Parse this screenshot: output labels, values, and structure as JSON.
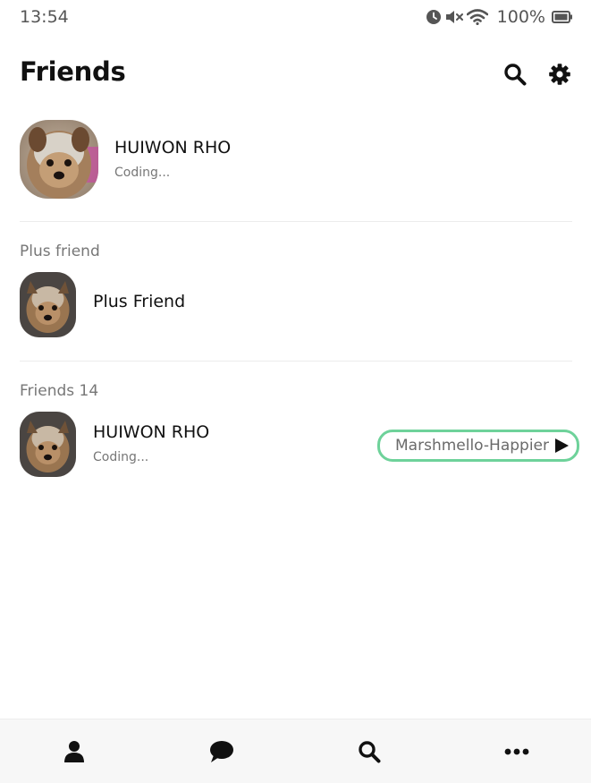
{
  "status_bar": {
    "time": "13:54",
    "battery": "100%",
    "icons": [
      "alarm-icon",
      "mute-icon",
      "wifi-icon",
      "battery-icon"
    ]
  },
  "header": {
    "title": "Friends",
    "icons": [
      "search-icon",
      "gear-icon"
    ]
  },
  "my_profile": {
    "name": "HUIWON RHO",
    "status": "Coding..."
  },
  "plus_friend": {
    "section_label": "Plus friend",
    "name": "Plus Friend"
  },
  "friends": {
    "section_label": "Friends 14",
    "items": [
      {
        "name": "HUIWON RHO",
        "status": "Coding...",
        "music": "Marshmello-Happier"
      }
    ]
  },
  "bottom_nav": {
    "items": [
      "person-icon",
      "chat-bubble-icon",
      "search-icon",
      "more-icon"
    ]
  },
  "colors": {
    "accent_border": "#6ed29a",
    "text_primary": "#111111",
    "text_secondary": "#777777",
    "nav_background": "#f7f7f7"
  }
}
